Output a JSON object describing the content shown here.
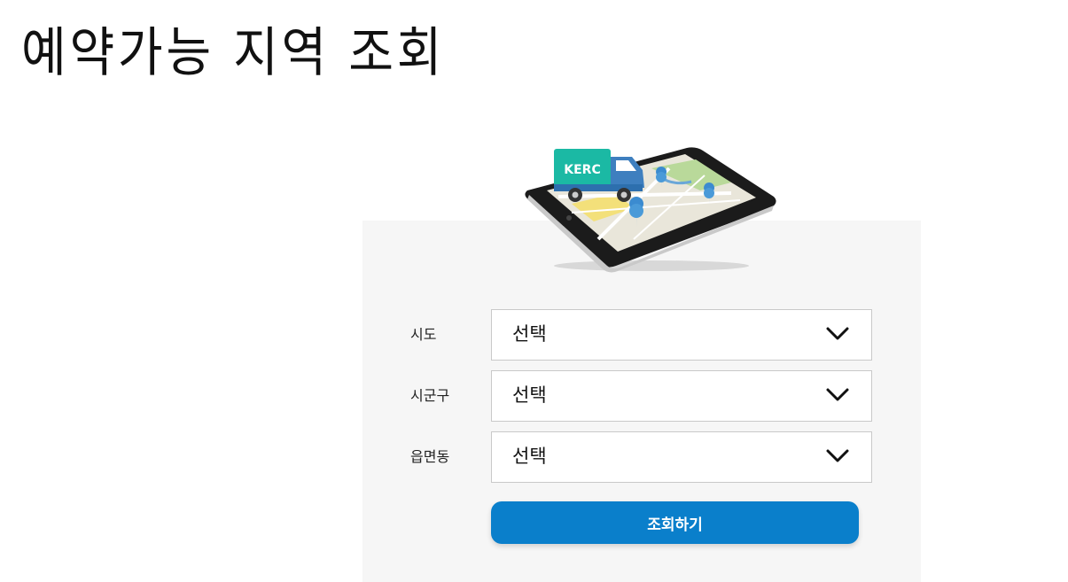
{
  "page": {
    "title": "예약가능 지역 조회"
  },
  "illustration": {
    "badge_text": "KERC",
    "badge_color": "#1bb9a4",
    "truck_color": "#3e7fbf"
  },
  "form": {
    "fields": [
      {
        "label": "시도",
        "value": "선택"
      },
      {
        "label": "시군구",
        "value": "선택"
      },
      {
        "label": "읍면동",
        "value": "선택"
      }
    ],
    "submit_label": "조회하기"
  },
  "colors": {
    "accent": "#0a7fcb",
    "panel_bg": "#f6f6f6"
  }
}
